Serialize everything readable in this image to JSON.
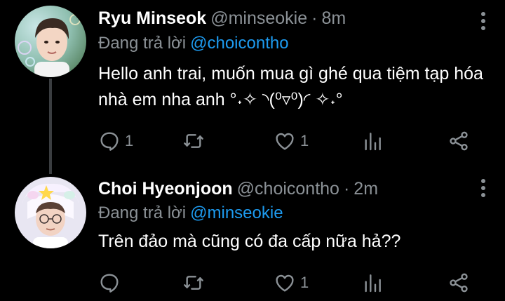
{
  "tweets": [
    {
      "name": "Ryu Minseok",
      "handle": "@minseokie",
      "separator": "·",
      "time": "8m",
      "reply_prefix": "Đang trả lời",
      "reply_to": "@choicontho",
      "text": "Hello anh trai, muốn mua gì ghé qua tiệm tạp hóa nhà em nha anh °˖✧ ◝(⁰▿⁰)◜ ✧˖°",
      "replies": "1",
      "retweets": "",
      "likes": "1"
    },
    {
      "name": "Choi Hyeonjoon",
      "handle": "@choicontho",
      "separator": "·",
      "time": "2m",
      "reply_prefix": "Đang trả lời",
      "reply_to": "@minseokie",
      "text": "Trên đảo mà cũng có đa cấp nữa hả??",
      "replies": "",
      "retweets": "",
      "likes": "1"
    }
  ],
  "colors": {
    "background": "#000000",
    "muted": "#8b9196",
    "link": "#1d9bf0",
    "text": "#ffffff"
  },
  "icons": [
    "reply-icon",
    "retweet-icon",
    "like-icon",
    "analytics-icon",
    "share-icon",
    "more-icon"
  ]
}
